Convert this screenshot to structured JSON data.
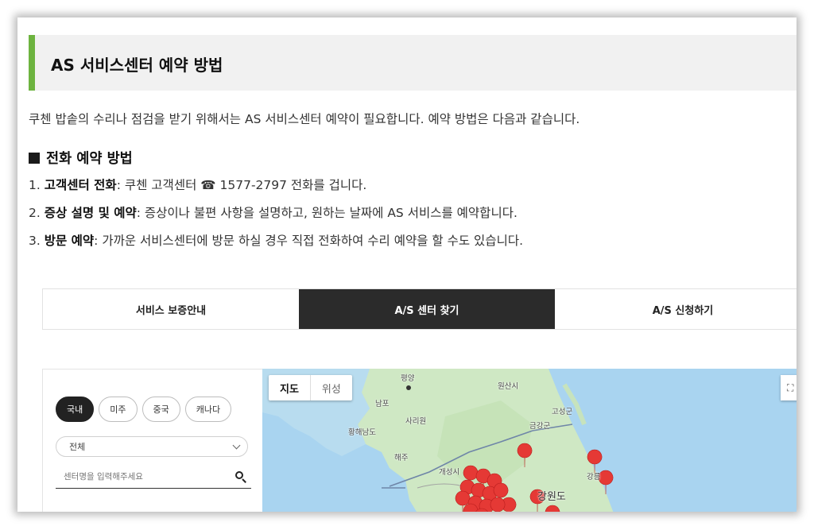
{
  "heading": {
    "title": "AS 서비스센터 예약 방법"
  },
  "intro": "쿠첸 밥솥의 수리나 점검을 받기 위해서는 AS 서비스센터 예약이 필요합니다. 예약 방법은 다음과 같습니다.",
  "section": {
    "title": "전화 예약 방법",
    "steps": [
      {
        "num": "1.",
        "bold": "고객센터 전화",
        "text": ": 쿠첸 고객센터 ☎ 1577-2797  전화를 겁니다."
      },
      {
        "num": "2.",
        "bold": "증상 설명 및 예약",
        "text": ": 증상이나 불편 사항을 설명하고, 원하는 날짜에 AS 서비스를 예약합니다."
      },
      {
        "num": "3.",
        "bold": "방문 예약",
        "text": ": 가까운 서비스센터에 방문 하실 경우 직접 전화하여 수리 예약을 할 수도 있습니다."
      }
    ]
  },
  "tabs": [
    {
      "label": "서비스 보증안내",
      "active": false
    },
    {
      "label": "A/S 센터 찾기",
      "active": true
    },
    {
      "label": "A/S 신청하기",
      "active": false
    }
  ],
  "filter": {
    "regions": [
      "국내",
      "미주",
      "중국",
      "캐나다"
    ],
    "active_region": "국내",
    "select_value": "전체",
    "search_placeholder": "센터명을 입력해주세요"
  },
  "map": {
    "toggle": [
      "지도",
      "위성"
    ],
    "labels": {
      "pyongyang": "평양",
      "nampo": "남포",
      "sariwon": "사리원",
      "hwanghae": "황해남도",
      "haeju": "해주",
      "gaeseong": "개성시",
      "wonsan": "원산시",
      "gosong": "고성군",
      "geumgang": "금강군",
      "gangwon": "강원도",
      "gangneung": "강릉",
      "do": "도"
    },
    "colors": {
      "water": "#a9d4f0",
      "land": "#cfe8c4",
      "marker": "#e53935"
    }
  }
}
